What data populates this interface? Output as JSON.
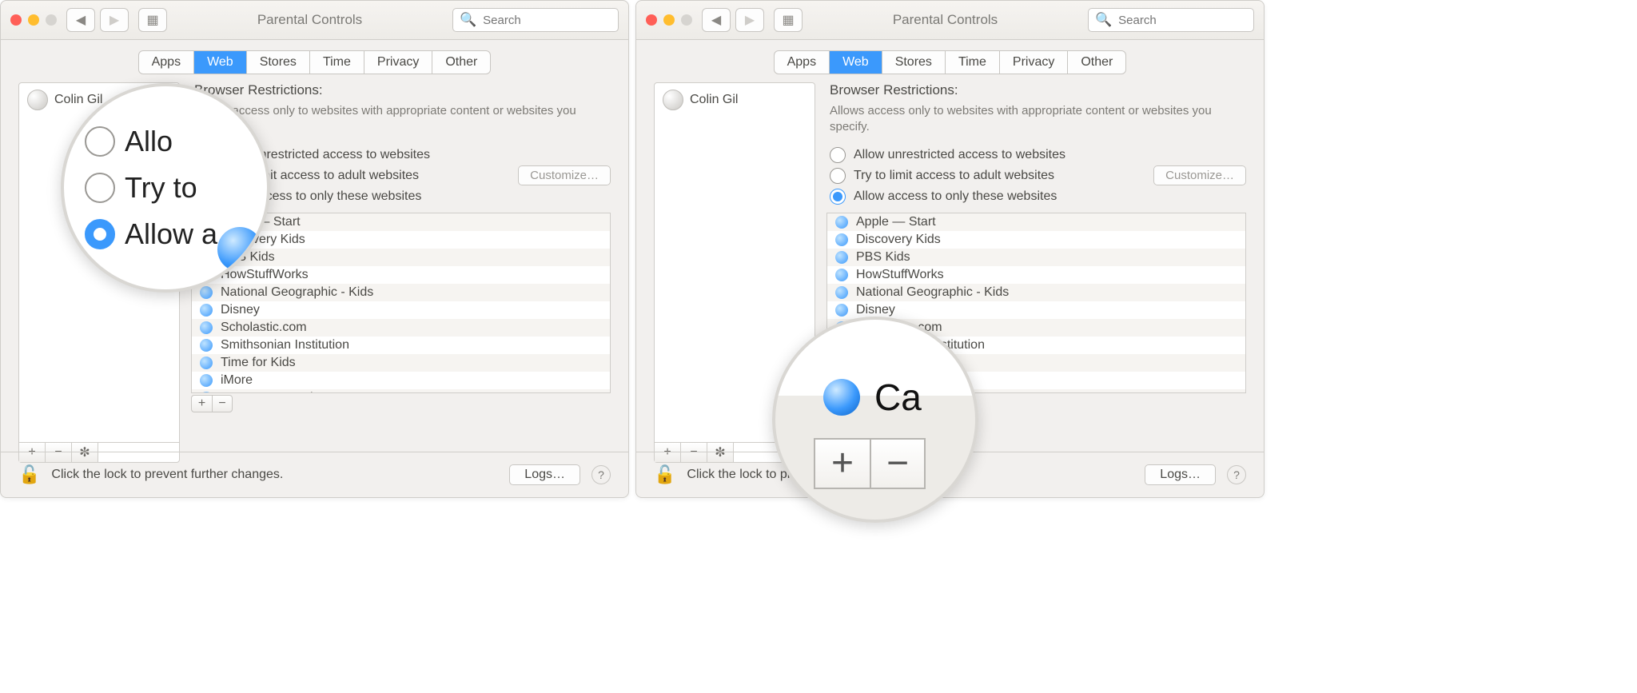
{
  "window": {
    "title": "Parental Controls",
    "search_placeholder": "Search",
    "tabs": [
      "Apps",
      "Web",
      "Stores",
      "Time",
      "Privacy",
      "Other"
    ],
    "active_tab_index": 1
  },
  "sidebar": {
    "users": [
      {
        "name": "Colin Gil"
      }
    ],
    "tools": {
      "add": "+",
      "remove": "−",
      "gear": "✻"
    }
  },
  "browser_restrictions": {
    "heading": "Browser Restrictions:",
    "description": "Allows access only to websites with appropriate content or websites you specify.",
    "options": [
      {
        "label": "Allow unrestricted access to websites",
        "selected": false
      },
      {
        "label": "Try to limit access to adult websites",
        "selected": false,
        "customize": "Customize…"
      },
      {
        "label": "Allow access to only these websites",
        "selected": true
      }
    ],
    "websites": [
      "Apple — Start",
      "Discovery Kids",
      "PBS Kids",
      "HowStuffWorks",
      "National Geographic - Kids",
      "Disney",
      "Scholastic.com",
      "Smithsonian Institution",
      "Time for Kids",
      "iMore",
      "Cartoon Network games"
    ],
    "list_tools": {
      "add": "+",
      "remove": "−"
    }
  },
  "footer": {
    "lock_hint": "Click the lock to prevent further changes.",
    "logs": "Logs…",
    "help": "?"
  },
  "mag_a": {
    "r1": "Allo",
    "r2": "Try to",
    "r3": "Allow a"
  },
  "mag_b": {
    "row_text": "Ca",
    "plus": "+",
    "minus": "−"
  }
}
